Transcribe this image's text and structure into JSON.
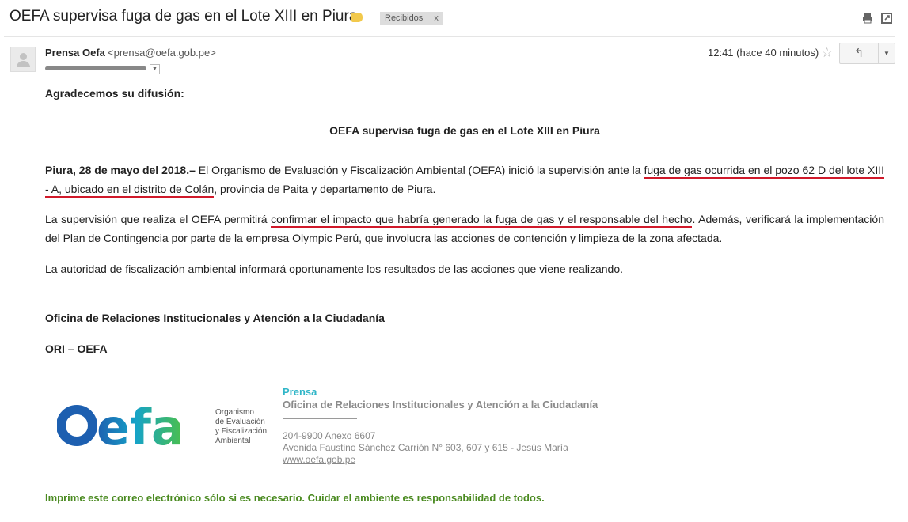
{
  "email": {
    "subject": "OEFA supervisa fuga de gas en el Lote XIII en Piura",
    "label": "Recibidos",
    "label_remove": "x",
    "sender_name": "Prensa Oefa",
    "sender_email": "<prensa@oefa.gob.pe>",
    "time": "12:41 (hace 40 minutos)"
  },
  "icons": {
    "print": "print-icon",
    "new_window": "new-window-icon",
    "star": "star-icon",
    "reply": "reply-icon",
    "more": "chevron-down-icon"
  },
  "body": {
    "greeting": "Agradecemos su difusión:",
    "headline": "OEFA supervisa fuga de gas en el Lote XIII en Piura",
    "p1_dateline": "Piura, 28 de mayo del 2018.–",
    "p1_text_a": " El Organismo de Evaluación y Fiscalización Ambiental (OEFA) inició la supervisión ante la ",
    "p1_underlined": "fuga de gas ocurrida en el pozo 62 D del lote XIII - A, ubicado en el distrito de Colán",
    "p1_text_b": ", provincia de Paita y departamento de Piura.",
    "p2_text_a": "La supervisión que realiza el OEFA permitirá ",
    "p2_underlined": "confirmar el impacto que habría generado la fuga de gas y el responsable del hecho",
    "p2_text_b": ". Además, verificará la implementación del Plan de Contingencia por parte de la empresa Olympic Perú, que involucra las acciones de contención y limpieza de la zona afectada.",
    "p3": "La autoridad de fiscalización ambiental informará oportunamente los resultados de las acciones que viene realizando.",
    "office": "Oficina de Relaciones Institucionales y Atención a la Ciudadanía",
    "ori": "ORI – OEFA"
  },
  "signature": {
    "logo_text": "Oefa",
    "logo_desc": [
      "Organismo",
      "de Evaluación",
      "y Fiscalización",
      "Ambiental"
    ],
    "prensa": "Prensa",
    "office": "Oficina de Relaciones Institucionales y Atención a la Ciudadanía",
    "phone": "204-9900 Anexo 6607",
    "address": "Avenida Faustino Sánchez Carrión N° 603, 607 y 615 - Jesús María",
    "website": "www.oefa.gob.pe",
    "footer_note": "Imprime este correo electrónico sólo si es necesario. Cuidar el ambiente es responsabilidad de todos."
  },
  "colors": {
    "underline": "#d0192a",
    "prensa": "#31b6c8",
    "footer_green": "#4a8a20",
    "logo_blue": "#1d6fb8",
    "logo_green": "#45b649"
  }
}
